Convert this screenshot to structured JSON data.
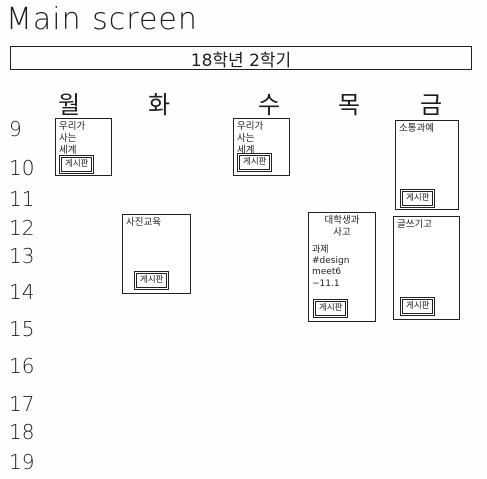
{
  "screen": {
    "title": "Main screen",
    "semester": "18학년 2학기"
  },
  "days": [
    "월",
    "화",
    "수",
    "목",
    "금"
  ],
  "hours": [
    "9",
    "10",
    "11",
    "12",
    "13",
    "14",
    "15",
    "16",
    "17",
    "18",
    "19"
  ],
  "courses": [
    {
      "name": "우리가\n사는\n세계",
      "board": "게시판"
    },
    {
      "name": "우리가\n사는\n세계",
      "board": "게시판"
    },
    {
      "name": "소통과예",
      "board": "게시판"
    },
    {
      "name": "사진교육",
      "board": "게시판"
    },
    {
      "name": "대학생과\n사고",
      "detail": "과제\n#design\nmeet6\n~11.1",
      "board": "게시판"
    },
    {
      "name": "글쓰기고",
      "board": "게시판"
    }
  ]
}
